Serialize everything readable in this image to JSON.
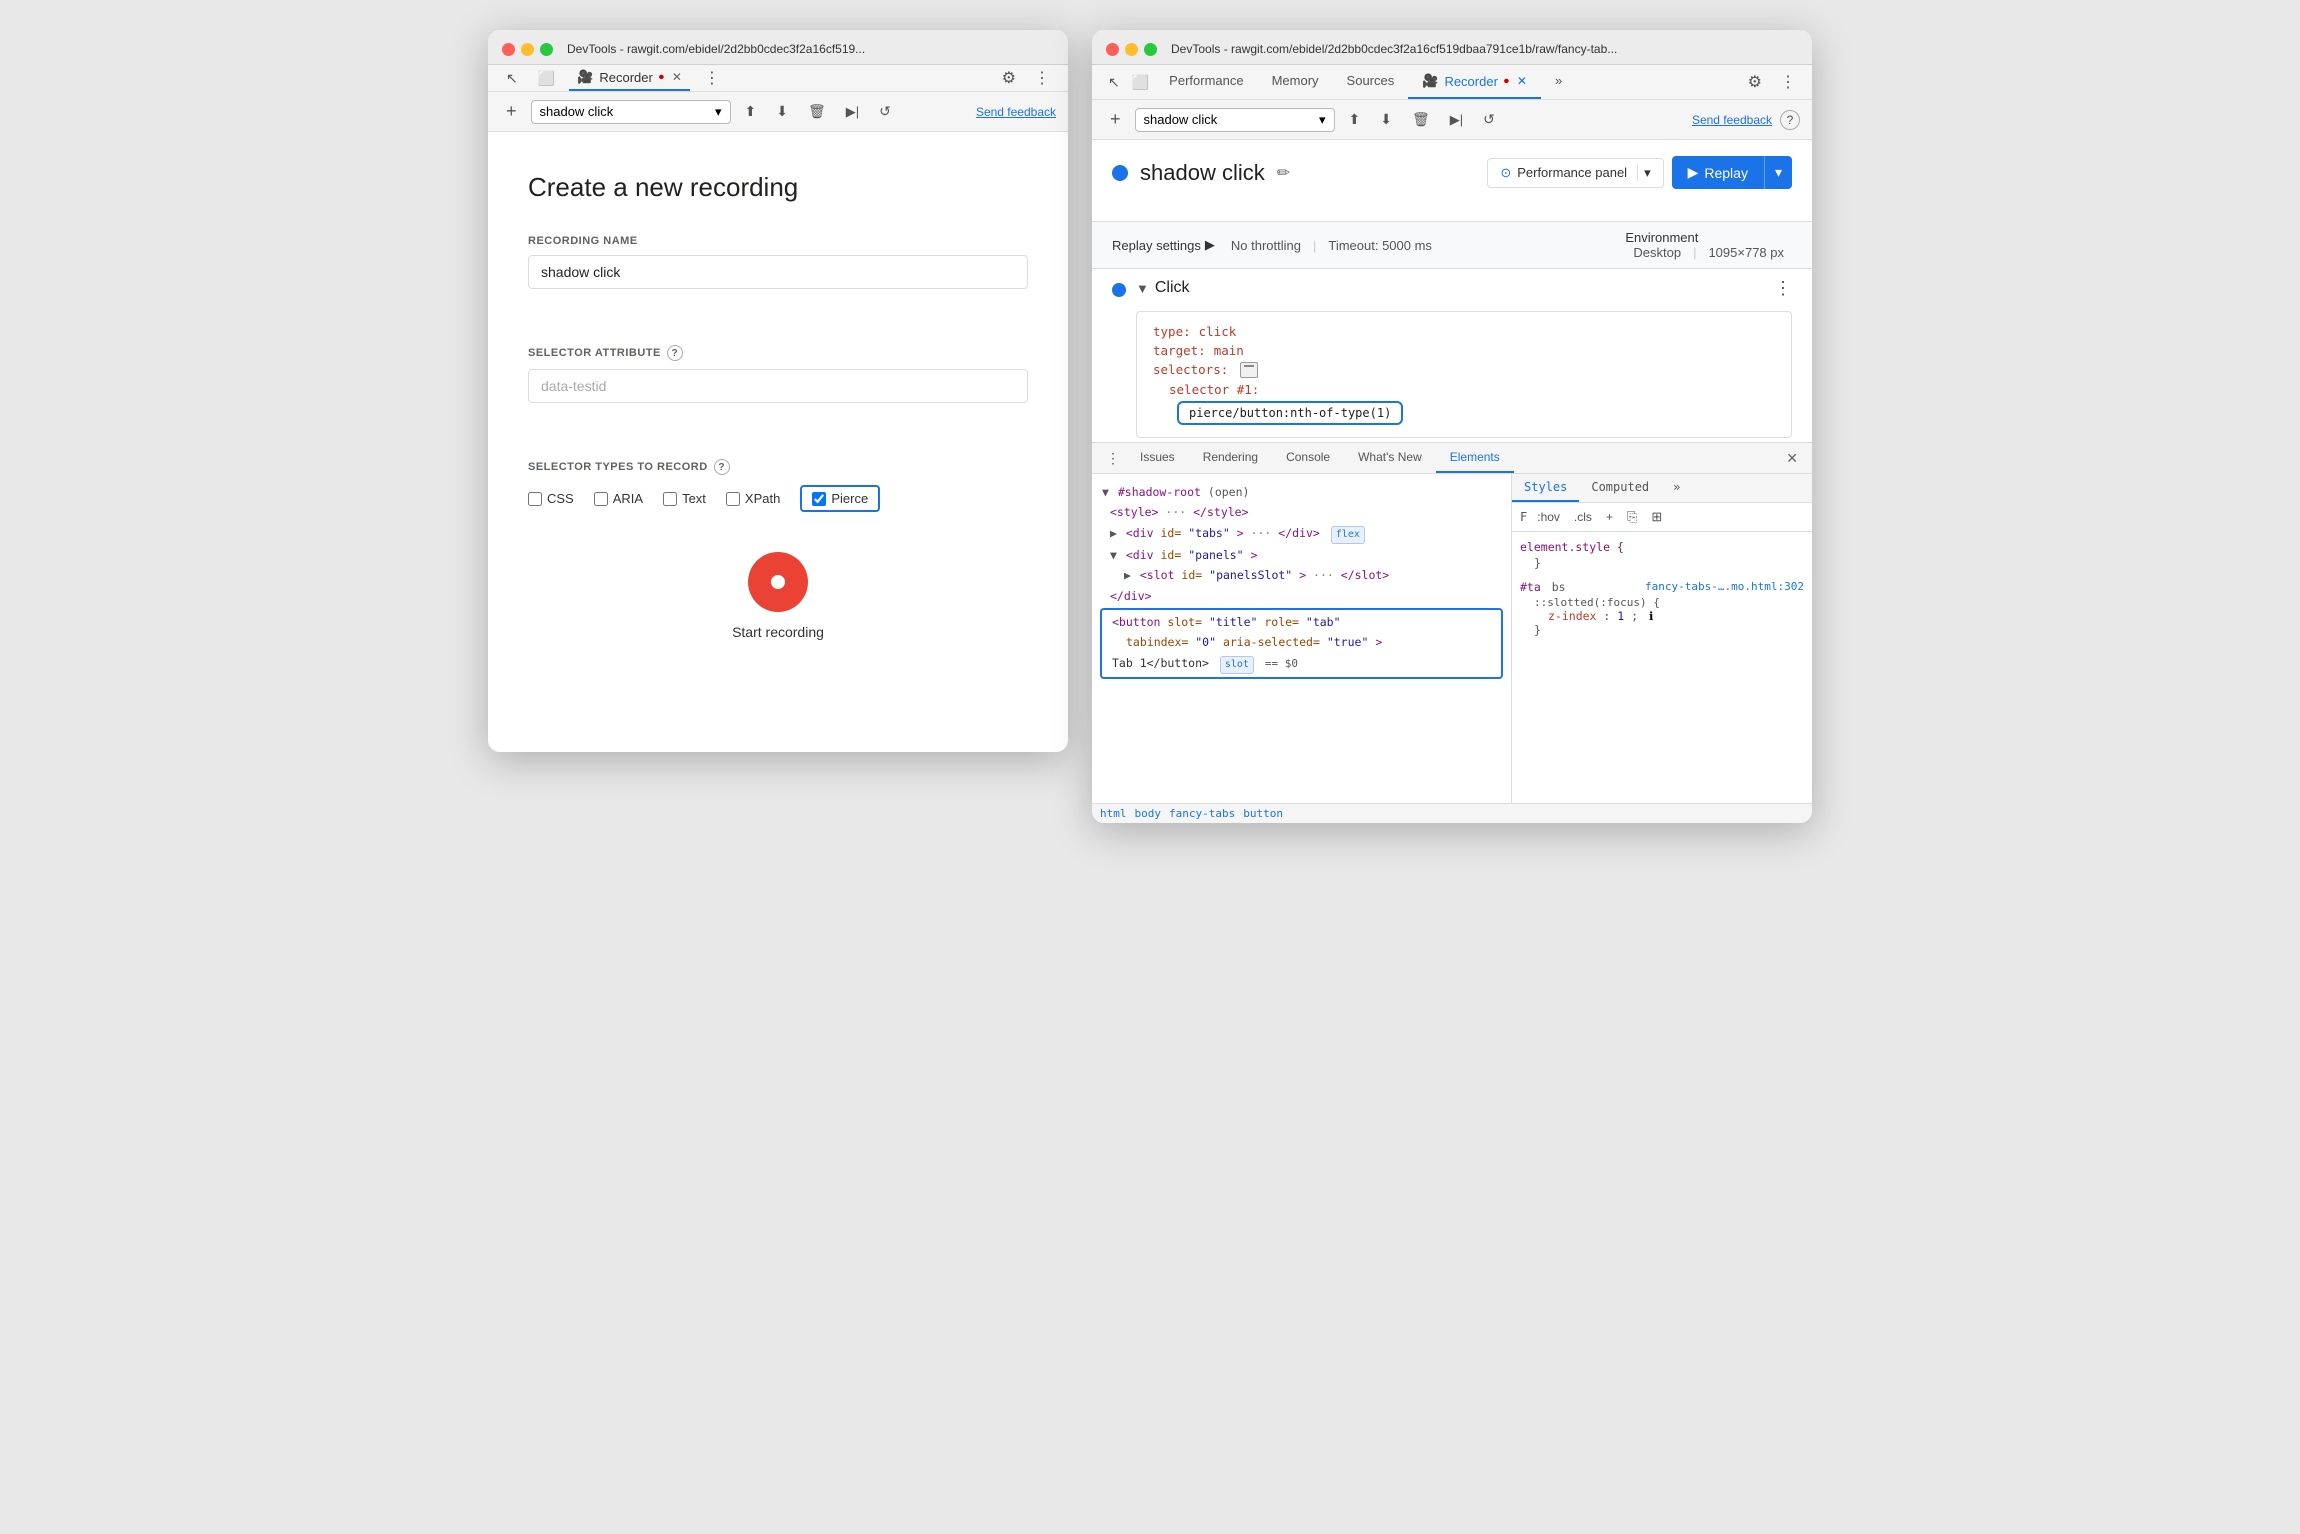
{
  "leftWindow": {
    "titleBar": {
      "title": "DevTools - rawgit.com/ebidel/2d2bb0cdec3f2a16cf519...",
      "tabLabel": "Recorder",
      "tabIcon": "🎥"
    },
    "toolbar": {
      "newRecording": "+",
      "recordingName": "shadow click",
      "uploadLabel": "⬆",
      "downloadLabel": "⬇",
      "deleteLabel": "🗑",
      "playLabel": "▶",
      "rewindLabel": "↺",
      "feedbackLabel": "Send feedback",
      "settingsLabel": "⚙",
      "moreLabel": "⋮"
    },
    "form": {
      "title": "Create a new recording",
      "recordingNameLabel": "RECORDING NAME",
      "recordingNameValue": "shadow click",
      "selectorAttrLabel": "SELECTOR ATTRIBUTE",
      "selectorAttrPlaceholder": "data-testid",
      "selectorTypesLabel": "SELECTOR TYPES TO RECORD",
      "checkboxCSS": "CSS",
      "checkboxARIA": "ARIA",
      "checkboxText": "Text",
      "checkboxXPath": "XPath",
      "checkboxPierce": "Pierce",
      "startButton": "Start recording"
    }
  },
  "rightWindow": {
    "titleBar": {
      "title": "DevTools - rawgit.com/ebidel/2d2bb0cdec3f2a16cf519dbaa791ce1b/raw/fancy-tab..."
    },
    "navTabs": {
      "performance": "Performance",
      "memory": "Memory",
      "sources": "Sources",
      "recorder": "Recorder",
      "more": "»",
      "settings": "⚙",
      "menu": "⋮"
    },
    "toolbar": {
      "newRecording": "+",
      "recordingName": "shadow click",
      "uploadLabel": "⬆",
      "downloadLabel": "⬇",
      "deleteLabel": "🗑",
      "playLabel": "▶",
      "rewindLabel": "↺",
      "feedbackLabel": "Send feedback"
    },
    "recordingHeader": {
      "title": "shadow click",
      "editIcon": "✏",
      "performancePanelLabel": "Performance panel",
      "replayLabel": "Replay"
    },
    "replaySettings": {
      "label": "Replay settings",
      "triangle": "▶",
      "throttlingLabel": "No throttling",
      "timeoutLabel": "Timeout: 5000 ms",
      "envLabel": "Environment",
      "envValue": "Desktop",
      "envSize": "1095×778 px"
    },
    "step": {
      "stepType": "Click",
      "typeKey": "type:",
      "typeVal": "click",
      "targetKey": "target:",
      "targetVal": "main",
      "selectorsKey": "selectors:",
      "selector1Label": "selector #1:",
      "selector1Val": "pierce/button:nth-of-type(1)"
    },
    "devtools": {
      "tabs": [
        "Issues",
        "Rendering",
        "Console",
        "What's New",
        "Elements"
      ],
      "activeTab": "Elements",
      "closeIcon": "✕",
      "stylesTabs": [
        "Styles",
        "Computed",
        "»"
      ],
      "stylesActive": "Styles",
      "stylesToolbar": {
        "filter": "F",
        "hov": ":hov",
        "cls": ".cls",
        "add": "+",
        "copy": "⎘",
        "toggle": "⊞"
      },
      "elements": {
        "shadowRoot": "▼ #shadow-root",
        "shadowRootSuffix": "(open)",
        "style": "<style>···</style>",
        "divTabs": "<div id=\"tabs\">···</div>",
        "divTabsFlex": "flex",
        "divPanels": "▼ <div id=\"panels\">",
        "slotPanels": "► <slot id=\"panelsSlot\">···</slot>",
        "slotPanelsEnd": "</slot>",
        "divEnd": "</div>",
        "buttonSelected": "<button slot=\"title\" role=\"tab\"",
        "buttonAttr": "tabindex=\"0\" aria-selected=\"true\">",
        "buttonContent": "Tab 1</button>",
        "buttonBadge": "slot",
        "buttonBadge2": "== $0"
      },
      "breadcrumb": [
        "html",
        "body",
        "fancy-tabs",
        "button"
      ],
      "styles": {
        "rule1": {
          "selector": "element.style {",
          "end": "}",
          "props": []
        },
        "rule2": {
          "selector": "#ta",
          "source": "fancy-tabs-….mo.html:302",
          "sourceSuffix": "bs",
          "props": [
            "::slotted(:focus) {"
          ],
          "propLines": [
            "z-index: 1;"
          ],
          "end": "}"
        }
      }
    }
  }
}
